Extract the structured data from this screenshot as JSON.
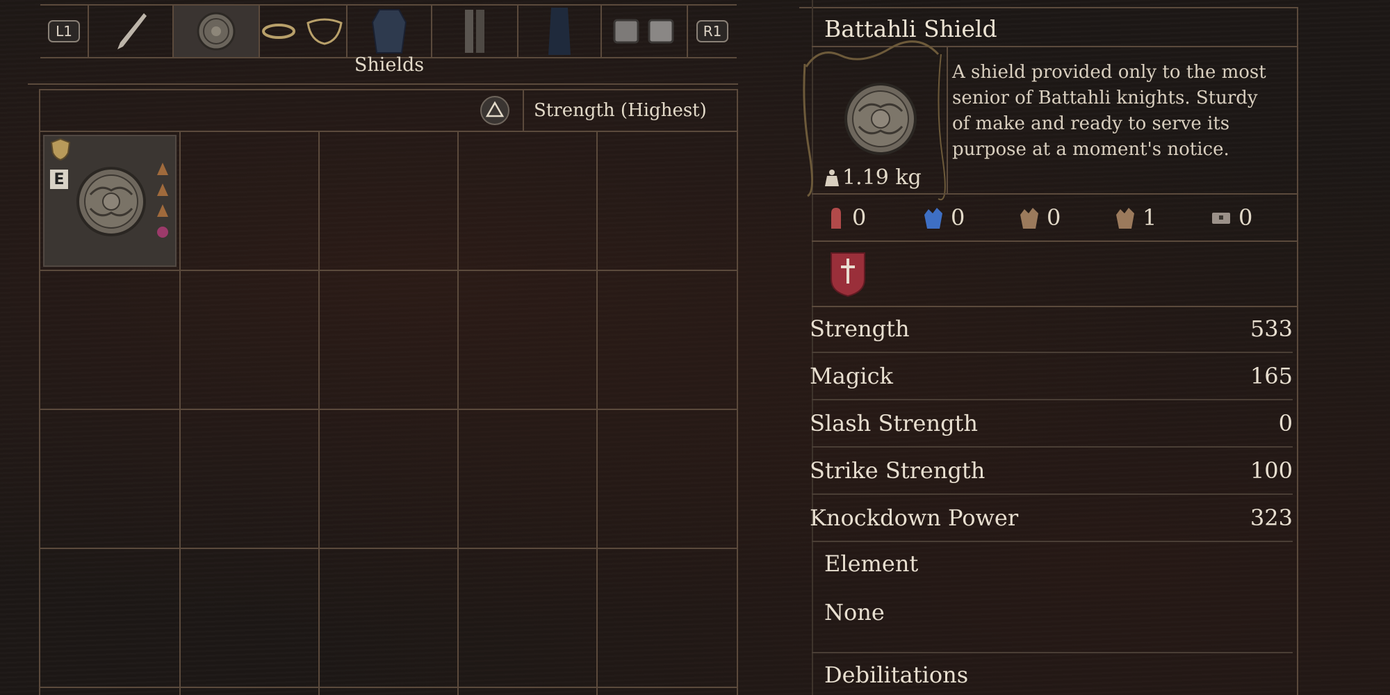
{
  "tabs": {
    "left_key": "L1",
    "right_key": "R1",
    "items": [
      {
        "name": "weapon-tab",
        "icon": "sword-icon"
      },
      {
        "name": "shield-tab",
        "icon": "shield-icon",
        "selected": true
      },
      {
        "name": "rings-tab",
        "icon": "ring-icon"
      },
      {
        "name": "body-armor-tab",
        "icon": "armor-icon"
      },
      {
        "name": "leg-armor-tab",
        "icon": "greaves-icon"
      },
      {
        "name": "cloak-tab",
        "icon": "cloak-icon"
      },
      {
        "name": "accessory-tab",
        "icon": "ring-box-icon"
      }
    ]
  },
  "category": "Shields",
  "sort": {
    "button_icon": "triangle-icon",
    "label": "Strength (Highest)"
  },
  "inventory": {
    "equipped_badge": "E",
    "item_icon": "battahli-shield-icon"
  },
  "detail": {
    "name": "Battahli Shield",
    "description": "A shield provided only to the most senior of Battahli knights. Sturdy of make and ready to serve its purpose at a moment's notice.",
    "weight": "1.19 kg",
    "resistances": [
      {
        "icon": "red-hand-icon",
        "value": "0",
        "color": "#b14a4a"
      },
      {
        "icon": "blue-hand-icon",
        "value": "0",
        "color": "#3e6fc4"
      },
      {
        "icon": "brown-hand-icon",
        "value": "0",
        "color": "#9b7a5c"
      },
      {
        "icon": "hand-2-icon",
        "value": "1",
        "color": "#9b7a5c"
      },
      {
        "icon": "chest-icon",
        "value": "0",
        "color": "#9b9189"
      }
    ],
    "vocation_icon": "fighter-vocation-icon",
    "stats": [
      {
        "label": "Strength",
        "value": "533"
      },
      {
        "label": "Magick",
        "value": "165"
      },
      {
        "label": "Slash Strength",
        "value": "0"
      },
      {
        "label": "Strike Strength",
        "value": "100"
      },
      {
        "label": "Knockdown Power",
        "value": "323"
      }
    ],
    "element_label": "Element",
    "element_value": "None",
    "debilitations_label": "Debilitations"
  },
  "colors": {
    "accent": "#9a2f3a",
    "text": "#e3dac9",
    "lines": "#5b4a3c"
  }
}
